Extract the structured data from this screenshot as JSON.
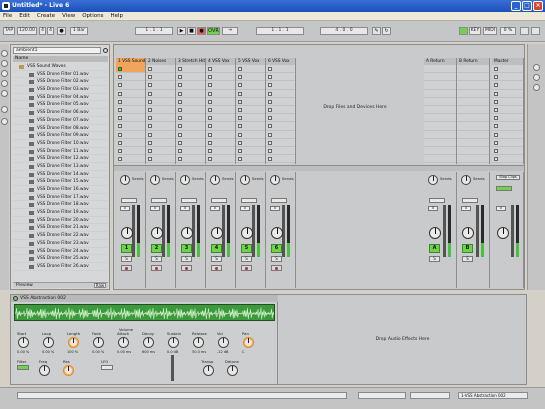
{
  "window": {
    "title": "Untitled* - Live 6"
  },
  "menu": [
    "File",
    "Edit",
    "Create",
    "View",
    "Options",
    "Help"
  ],
  "transport": {
    "tap": "TAP",
    "tempo": "120.00",
    "meter_num": "4",
    "meter_den": "4",
    "quantize": "1 Bar",
    "position": "1 . 1 . 1",
    "key": "KEY",
    "midi": "MIDI",
    "cpu": "0 %",
    "ovr": "OVR"
  },
  "browser": {
    "search_value": "ambient1",
    "header": "Name",
    "folder": "VSS Sound Waves",
    "files": [
      "VSS Drone Filter 01.wav",
      "VSS Drone Filter 02.wav",
      "VSS Drone Filter 03.wav",
      "VSS Drone Filter 04.wav",
      "VSS Drone Filter 05.wav",
      "VSS Drone Filter 06.wav",
      "VSS Drone Filter 07.wav",
      "VSS Drone Filter 08.wav",
      "VSS Drone Filter 09.wav",
      "VSS Drone Filter 10.wav",
      "VSS Drone Filter 11.wav",
      "VSS Drone Filter 12.wav",
      "VSS Drone Filter 13.wav",
      "VSS Drone Filter 14.wav",
      "VSS Drone Filter 15.wav",
      "VSS Drone Filter 16.wav",
      "VSS Drone Filter 17.wav",
      "VSS Drone Filter 18.wav",
      "VSS Drone Filter 19.wav",
      "VSS Drone Filter 20.wav",
      "VSS Drone Filter 21.wav",
      "VSS Drone Filter 22.wav",
      "VSS Drone Filter 23.wav",
      "VSS Drone Filter 24.wav",
      "VSS Drone Filter 25.wav",
      "VSS Drone Filter 26.wav"
    ],
    "footer": "Preview",
    "footer_btn": "Raw"
  },
  "session": {
    "tracks": [
      {
        "name": "1 VSS Sound",
        "num": "1"
      },
      {
        "name": "2 Noises",
        "num": "2"
      },
      {
        "name": "3 Stretch Hit",
        "num": "3"
      },
      {
        "name": "4 VSS Vox",
        "num": "4"
      },
      {
        "name": "5 VSS Vox",
        "num": "5"
      },
      {
        "name": "6 VSS Vox",
        "num": "6"
      }
    ],
    "returns": [
      {
        "name": "A Return",
        "num": "A"
      },
      {
        "name": "B Return",
        "num": "B"
      }
    ],
    "master": {
      "name": "Master"
    },
    "drop_text": "Drop Files and Devices Here",
    "send_label": "Sends",
    "volume_value": "0",
    "solo": "S",
    "stop_all": "Stop Clips"
  },
  "device": {
    "title": "VSS Abstraction 002",
    "params": [
      {
        "label": "Start",
        "value": "0.00 %"
      },
      {
        "label": "Loop",
        "value": "0.00 %"
      },
      {
        "label": "Length",
        "value": "100 %"
      },
      {
        "label": "Fade",
        "value": "0.00 %"
      },
      {
        "label": "Attack",
        "value": "0.00 ms"
      },
      {
        "label": "Decay",
        "value": "600 ms"
      },
      {
        "label": "Sustain",
        "value": "0.0 dB"
      },
      {
        "label": "Release",
        "value": "50.0 ms"
      },
      {
        "label": "Vol",
        "value": "-12 dB"
      },
      {
        "label": "Pan",
        "value": "C"
      }
    ],
    "volume_label": "Volume",
    "filter_label": "Filter",
    "freq_label": "Freq",
    "res_label": "Res",
    "lfo_label": "LFO",
    "transp_label": "Transp",
    "detune_label": "Detune",
    "drop_effects": "Drop Audio Effects Here"
  },
  "status": {
    "left": "",
    "right": "1-VSS Abstraction 002"
  },
  "colors": {
    "accent_green": "#6fd34e",
    "clip_orange": "#f1a45c",
    "panel_gray": "#c9cacc"
  }
}
